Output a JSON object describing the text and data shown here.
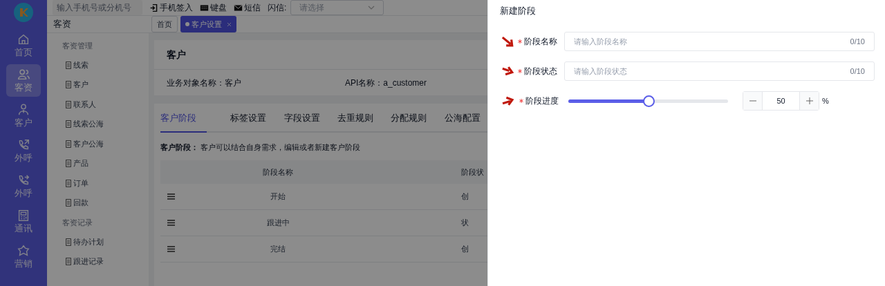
{
  "nav_rail": {
    "items": [
      {
        "label": "首页",
        "selected": false
      },
      {
        "label": "客资",
        "selected": true
      },
      {
        "label": "客户",
        "selected": false
      },
      {
        "label": "外呼",
        "selected": false
      },
      {
        "label": "外呼",
        "selected": false
      },
      {
        "label": "通讯",
        "selected": false
      },
      {
        "label": "营销",
        "selected": false
      }
    ]
  },
  "top_bar": {
    "search": {
      "placeholder": "输入手机号或分机号"
    },
    "actions": [
      "手机签入",
      "键盘",
      "短信"
    ],
    "flash_label": "闪信:",
    "flash_select": {
      "placeholder": "请选择"
    }
  },
  "sub_menu": {
    "title": "客资",
    "groups": [
      {
        "title": "客资管理",
        "items": [
          "线索",
          "客户",
          "联系人",
          "线索公海",
          "客户公海",
          "产品",
          "订单",
          "回款"
        ]
      },
      {
        "title": "客资记录",
        "items": [
          "待办计划",
          "跟进记录"
        ]
      }
    ]
  },
  "page_tabs": [
    {
      "label": "首页",
      "selected": false
    },
    {
      "label": "客户设置",
      "selected": true
    }
  ],
  "object_card": {
    "title": "客户",
    "name_label": "业务对象名称：客户",
    "api_label": "API名称：a_customer"
  },
  "settings_tabs": [
    {
      "label": "客户阶段",
      "selected": true
    },
    {
      "label": "标签设置",
      "selected": false
    },
    {
      "label": "字段设置",
      "selected": false
    },
    {
      "label": "去重规则",
      "selected": false
    },
    {
      "label": "分配规则",
      "selected": false
    },
    {
      "label": "公海配置",
      "selected": false
    }
  ],
  "description": "**客户阶段：** 客户可以结合自身需求，编辑或者新建客户阶段",
  "table": {
    "columns": [
      "阶段名称",
      "阶段状"
    ],
    "rows": [
      [
        "开始",
        "创"
      ],
      [
        "跟进中",
        "状"
      ],
      [
        "完结",
        "创"
      ]
    ]
  },
  "drawer": {
    "title": "新建阶段",
    "fields": [
      {
        "kind": "text",
        "label": "阶段名称",
        "required": true,
        "placeholder": "请输入阶段名称",
        "counter": "0/10"
      },
      {
        "kind": "text",
        "label": "阶段状态",
        "required": true,
        "placeholder": "请输入阶段状态",
        "counter": "0/10"
      },
      {
        "kind": "slider",
        "label": "阶段进度",
        "required": true,
        "level": 0.5,
        "value": "50",
        "unit": "%"
      }
    ]
  }
}
